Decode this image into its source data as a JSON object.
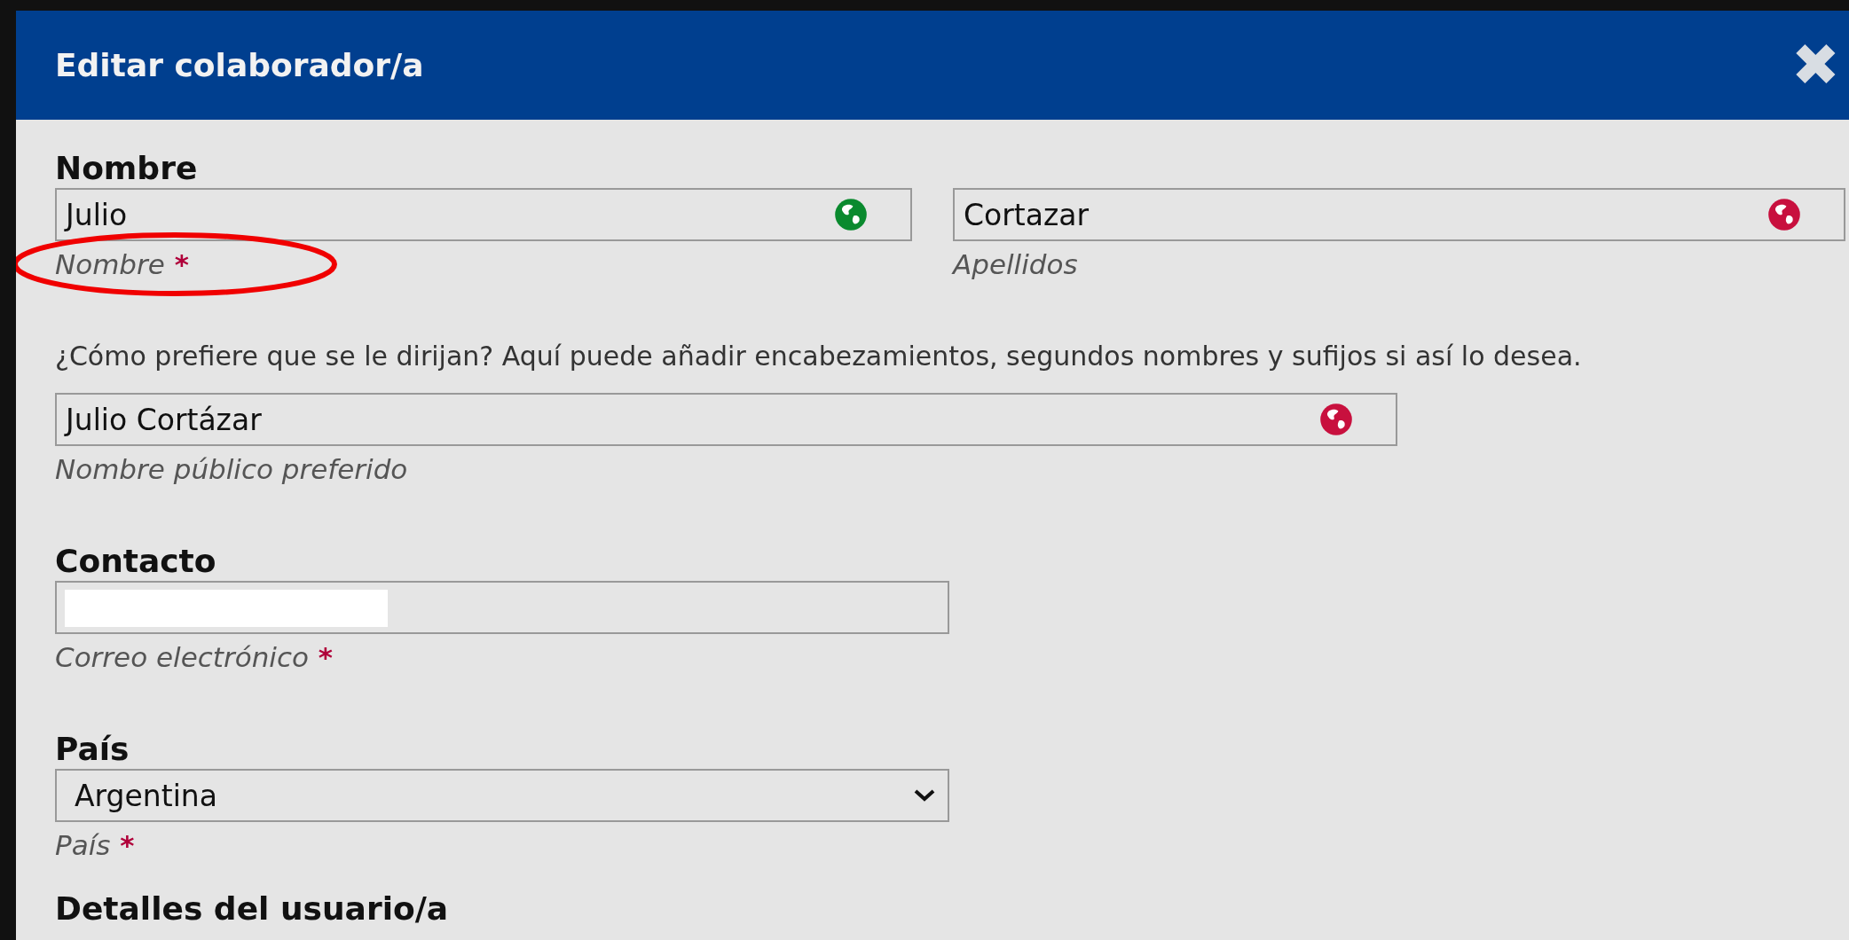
{
  "dialog": {
    "title": "Editar colaborador/a",
    "close_icon": "✖"
  },
  "sections": [
    {
      "heading": "Nombre",
      "fields": [
        {
          "kind": "text",
          "value": "Julio",
          "hint": "Nombre",
          "required": true,
          "color": "#0a8a2e",
          "circled": true
        },
        {
          "kind": "text",
          "value": "Cortazar",
          "hint": "Apellidos",
          "required": false,
          "color": "#c8103e"
        }
      ]
    },
    {
      "intro": "¿Cómo prefiere que se le dirijan? Aquí puede añadir encabezamientos, segundos nombres y sufijos si así lo desea.",
      "fields": [
        {
          "kind": "text",
          "value": "Julio Cortázar",
          "hint": "Nombre público preferido",
          "required": false,
          "color": "#c8103e"
        }
      ]
    },
    {
      "heading": "Contacto",
      "fields": [
        {
          "kind": "text",
          "redacted": true,
          "hint": "Correo electrónico",
          "required": true
        }
      ]
    },
    {
      "heading": "País",
      "fields": [
        {
          "kind": "select",
          "value": "Argentina",
          "hint": "País",
          "required": true
        }
      ]
    },
    {
      "heading": "Detalles del usuario/a"
    }
  ],
  "required_mark": "*"
}
